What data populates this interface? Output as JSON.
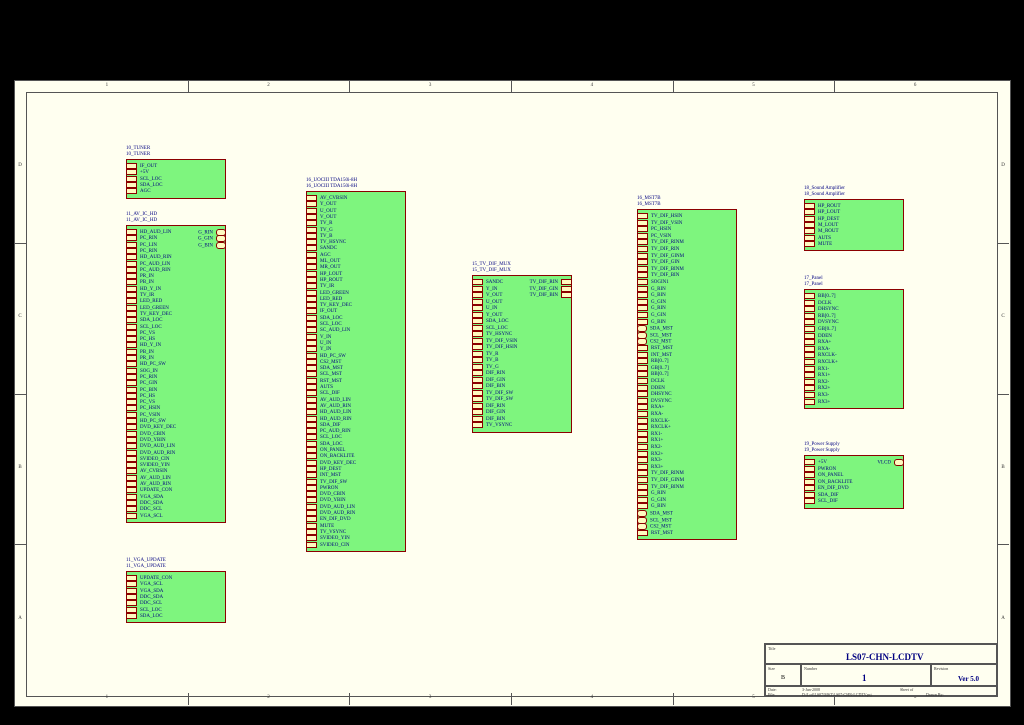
{
  "sheet": {
    "columns": [
      "1",
      "2",
      "3",
      "4",
      "5",
      "6"
    ],
    "rows": [
      "D",
      "C",
      "B",
      "A"
    ]
  },
  "blocks": [
    {
      "key": "tuner",
      "title1": "10_TUNER",
      "title2": "10_TUNER",
      "left": [
        {
          "label": "IF_OUT"
        },
        {
          "label": "+5V"
        },
        {
          "label": "SCL_LOC"
        },
        {
          "label": "SDA_LOC"
        },
        {
          "label": "AGC"
        }
      ],
      "right": []
    },
    {
      "key": "av",
      "title1": "11_AV_IC_HD",
      "title2": "11_AV_IC_HD",
      "left": [
        {
          "label": "HD_AUD_LIN"
        },
        {
          "label": "PC_RIN"
        },
        {
          "label": "PC_LIN"
        },
        {
          "label": "PC_RIN"
        },
        {
          "label": "HD_AUD_RIN"
        },
        {
          "label": "PC_AUD_LIN"
        },
        {
          "label": "PC_AUD_RIN"
        },
        {
          "label": "PR_IN"
        },
        {
          "label": "PB_IN"
        },
        {
          "label": "HD_Y_IN"
        },
        {
          "label": "TV_IR"
        },
        {
          "label": "LED_RED"
        },
        {
          "label": "LED_GREEN"
        },
        {
          "label": "TV_KEY_DEC"
        },
        {
          "label": "SDA_LOC"
        },
        {
          "label": "SCL_LOC"
        },
        {
          "label": "PC_VS"
        },
        {
          "label": "PC_HS"
        },
        {
          "label": "HD_Y_IN"
        },
        {
          "label": "PB_IN"
        },
        {
          "label": "PR_IN"
        },
        {
          "label": "HD_PC_SW"
        },
        {
          "label": "SOG_IN"
        },
        {
          "label": "PC_RIN"
        },
        {
          "label": "PC_GIN"
        },
        {
          "label": "PC_BIN"
        },
        {
          "label": "PC_HS"
        },
        {
          "label": "PC_VS"
        },
        {
          "label": "PC_HSIN"
        },
        {
          "label": "PC_VSIN"
        },
        {
          "label": "HD_PC_SW"
        },
        {
          "label": "DVD_KEY_DEC"
        },
        {
          "label": "DVD_CBIN"
        },
        {
          "label": "DVD_YBIN"
        },
        {
          "label": "DVD_AUD_LIN"
        },
        {
          "label": "DVD_AUD_RIN"
        },
        {
          "label": "SVIDEO_CIN"
        },
        {
          "label": "SVIDEO_YIN"
        },
        {
          "label": "AV_CVBSIN"
        },
        {
          "label": "AV_AUD_LIN"
        },
        {
          "label": "AV_AUD_RIN"
        },
        {
          "label": "UPDATE_CON"
        },
        {
          "label": "VGA_SDA"
        },
        {
          "label": "DDC_SDA"
        },
        {
          "label": "DDC_SCL"
        },
        {
          "label": "VGA_SCL"
        }
      ],
      "right": [
        {
          "label": "G_RIN",
          "shape": "oval"
        },
        {
          "label": "G_GIN",
          "shape": "oval"
        },
        {
          "label": "G_BIN",
          "shape": "oval"
        }
      ]
    },
    {
      "key": "vga",
      "title1": "11_VGA_UPDATE",
      "title2": "11_VGA_UPDATE",
      "left": [
        {
          "label": "UPDATE_CON"
        },
        {
          "label": "VGA_SCL"
        },
        {
          "label": "VGA_SDA"
        },
        {
          "label": "DDC_SDA"
        },
        {
          "label": "DDC_SCL"
        },
        {
          "label": "SCL_LOC"
        },
        {
          "label": "SDA_LOC"
        }
      ],
      "right": []
    },
    {
      "key": "uoc",
      "title1": "16_UOCIII TDA150i-8H",
      "title2": "16_UOCIII TDA150i-8H",
      "left": [
        {
          "label": "AV_CVBSIN"
        },
        {
          "label": "Y_OUT"
        },
        {
          "label": "U_OUT"
        },
        {
          "label": "V_OUT"
        },
        {
          "label": "TV_R"
        },
        {
          "label": "TV_G"
        },
        {
          "label": "TV_B"
        },
        {
          "label": "TV_HSYNC"
        },
        {
          "label": "SANDC"
        },
        {
          "label": "AGC"
        },
        {
          "label": "ML_OUT"
        },
        {
          "label": "MR_OUT"
        },
        {
          "label": "HP_LOUT"
        },
        {
          "label": "HP_ROUT"
        },
        {
          "label": "TV_IR"
        },
        {
          "label": "LED_GREEN"
        },
        {
          "label": "LED_RED"
        },
        {
          "label": "TV_KEY_DEC"
        },
        {
          "label": "IF_OUT"
        },
        {
          "label": "SDA_LOC"
        },
        {
          "label": "SCL_LOC"
        },
        {
          "label": "SC_AUD_LIN"
        },
        {
          "label": "V_IN"
        },
        {
          "label": "U_IN"
        },
        {
          "label": "Y_IN"
        },
        {
          "label": "HD_PC_SW"
        },
        {
          "label": "CS2_MST"
        },
        {
          "label": "SDA_MST"
        },
        {
          "label": "SCL_MST"
        },
        {
          "label": "RST_MST"
        },
        {
          "label": "AUTS"
        },
        {
          "label": "SCL_DIF"
        },
        {
          "label": "AV_AUD_LIN"
        },
        {
          "label": "AV_AUD_RIN"
        },
        {
          "label": "HD_AUD_LIN"
        },
        {
          "label": "HD_AUD_RIN"
        },
        {
          "label": "SDA_DIF"
        },
        {
          "label": "PC_AUD_RIN"
        },
        {
          "label": "SCL_LOC"
        },
        {
          "label": "SDA_LOC"
        },
        {
          "label": "ON_PANEL"
        },
        {
          "label": "ON_BACKLITE"
        },
        {
          "label": "DVD_KEY_DEC"
        },
        {
          "label": "HP_DEST"
        },
        {
          "label": "INT_MST"
        },
        {
          "label": "TV_DIF_SW"
        },
        {
          "label": "PWRON"
        },
        {
          "label": "DVD_CBIN"
        },
        {
          "label": "DVD_YBIN"
        },
        {
          "label": "DVD_AUD_LIN"
        },
        {
          "label": "DVD_AUD_RIN"
        },
        {
          "label": "EN_DIF_DVD"
        },
        {
          "label": "MUTE"
        },
        {
          "label": "TV_VSYNC"
        },
        {
          "label": "SVIDEO_YIN"
        },
        {
          "label": "SVIDEO_CIN"
        }
      ],
      "right": []
    },
    {
      "key": "dif",
      "title1": "15_TV_DIF_MUX",
      "title2": "15_TV_DIF_MUX",
      "left": [
        {
          "label": "SANDC"
        },
        {
          "label": "Y_IN"
        },
        {
          "label": "V_OUT"
        },
        {
          "label": "U_OUT"
        },
        {
          "label": "U_IN"
        },
        {
          "label": "Y_OUT"
        },
        {
          "label": "SDA_LOC"
        },
        {
          "label": "SCL_LOC"
        },
        {
          "label": "TV_HSYNC"
        },
        {
          "label": "TV_DIF_VSIN"
        },
        {
          "label": "TV_DIF_HSIN"
        },
        {
          "label": "TV_R"
        },
        {
          "label": "TV_B"
        },
        {
          "label": "TV_G"
        },
        {
          "label": "DIF_RIN"
        },
        {
          "label": "DIF_GIN"
        },
        {
          "label": "DIF_BIN"
        },
        {
          "label": "TV_DIF_SW"
        },
        {
          "label": "TV_DIF_SW"
        },
        {
          "label": "DIF_RIN"
        },
        {
          "label": "DIF_GIN"
        },
        {
          "label": "DIF_BIN"
        },
        {
          "label": "TV_VSYNC"
        }
      ],
      "right": [
        {
          "label": "TV_DIF_RIN",
          "shape": "pin"
        },
        {
          "label": "TV_DIF_GIN",
          "shape": "pin"
        },
        {
          "label": "TV_DIF_BIN",
          "shape": "pin"
        }
      ]
    },
    {
      "key": "mst",
      "title1": "16_MST7B",
      "title2": "16_MST7B",
      "left": [
        {
          "label": "TV_DIF_HSIN"
        },
        {
          "label": "TV_DIF_VSIN"
        },
        {
          "label": "PC_HSIN"
        },
        {
          "label": "PC_VSIN"
        },
        {
          "label": "TV_DIF_RINM"
        },
        {
          "label": "TV_DIF_RIN"
        },
        {
          "label": "TV_DIF_GINM"
        },
        {
          "label": "TV_DIF_GIN"
        },
        {
          "label": "TV_DIF_BINM"
        },
        {
          "label": "TV_DIF_BIN"
        },
        {
          "label": "SOGIN1"
        },
        {
          "label": "G_RIN"
        },
        {
          "label": "G_BIN"
        },
        {
          "label": "G_GIN"
        },
        {
          "label": "G_RIN"
        },
        {
          "label": "G_GIN"
        },
        {
          "label": "G_BIN"
        },
        {
          "label": "SDA_MST",
          "shape": "oval"
        },
        {
          "label": "SCL_MST",
          "shape": "oval"
        },
        {
          "label": "CS2_MST",
          "shape": "oval"
        },
        {
          "label": "RST_MST"
        },
        {
          "label": "INT_MST"
        },
        {
          "label": "RB[0..7]"
        },
        {
          "label": "GB[0..7]"
        },
        {
          "label": "BB[0..7]"
        },
        {
          "label": "DCLK"
        },
        {
          "label": "DDEN"
        },
        {
          "label": "DHSYNC"
        },
        {
          "label": "DVSYNC"
        },
        {
          "label": "RXA+"
        },
        {
          "label": "RXA-"
        },
        {
          "label": "RXCLK-"
        },
        {
          "label": "RXCLK+"
        },
        {
          "label": "RX1-"
        },
        {
          "label": "RX1+"
        },
        {
          "label": "RX2-"
        },
        {
          "label": "RX2+"
        },
        {
          "label": "RX3-"
        },
        {
          "label": "RX3+"
        },
        {
          "label": "TV_DIF_RINM"
        },
        {
          "label": "TV_DIF_GINM"
        },
        {
          "label": "TV_DIF_BINM"
        },
        {
          "label": "G_RIN"
        },
        {
          "label": "G_GIN"
        },
        {
          "label": "G_BIN"
        },
        {
          "label": "SDA_MST",
          "shape": "oval"
        },
        {
          "label": "SCL_MST",
          "shape": "oval"
        },
        {
          "label": "CS2_MST",
          "shape": "oval"
        },
        {
          "label": "RST_MST"
        }
      ],
      "right": []
    },
    {
      "key": "sound",
      "title1": "18_Sound Amplifier",
      "title2": "18_Sound Amplifier",
      "left": [
        {
          "label": "HP_ROUT"
        },
        {
          "label": "HP_LOUT"
        },
        {
          "label": "HP_DEST"
        },
        {
          "label": "M_LOUT"
        },
        {
          "label": "M_ROUT"
        },
        {
          "label": "AUTS"
        },
        {
          "label": "MUTE"
        }
      ],
      "right": []
    },
    {
      "key": "panel",
      "title1": "17_Panel",
      "title2": "17_Panel",
      "left": [
        {
          "label": "BB[0..7]"
        },
        {
          "label": "DCLK"
        },
        {
          "label": "DHSYNC"
        },
        {
          "label": "RB[0..7]"
        },
        {
          "label": "DVSYNC"
        },
        {
          "label": "GB[0..7]"
        },
        {
          "label": "DDEN"
        },
        {
          "label": "RXA+"
        },
        {
          "label": "RXA-"
        },
        {
          "label": "RXCLK-"
        },
        {
          "label": "RXCLK+"
        },
        {
          "label": "RX1-"
        },
        {
          "label": "RX1+"
        },
        {
          "label": "RX2-"
        },
        {
          "label": "RX2+"
        },
        {
          "label": "RX3-"
        },
        {
          "label": "RX3+"
        }
      ],
      "right": []
    },
    {
      "key": "power",
      "title1": "19_Power Supply",
      "title2": "19_Power Supply",
      "left": [
        {
          "label": "+5V"
        },
        {
          "label": "PWRON"
        },
        {
          "label": "ON_PANEL"
        },
        {
          "label": "ON_BACKLITE"
        },
        {
          "label": "EN_DIF_DVD"
        },
        {
          "label": "SDA_DIF"
        },
        {
          "label": "SCL_DIF"
        }
      ],
      "right": [
        {
          "label": "VLCD",
          "shape": "oval"
        }
      ]
    }
  ],
  "titleblock": {
    "title_label": "Title",
    "title": "LS07-CHN-LCDTV",
    "size_label": "Size",
    "size": "B",
    "number_label": "Number",
    "number": "1",
    "revision_label": "Revision",
    "revision": "Ver 5.0",
    "date_label": "Date:",
    "date": "3-Jan-2008",
    "file_label": "File:",
    "file": "D:\\Lcd\\LS07\\MST\\LS07-CHN-LCDTV.prj",
    "sheet_label": "Sheet  of",
    "drawn_label": "Drawn By:"
  }
}
